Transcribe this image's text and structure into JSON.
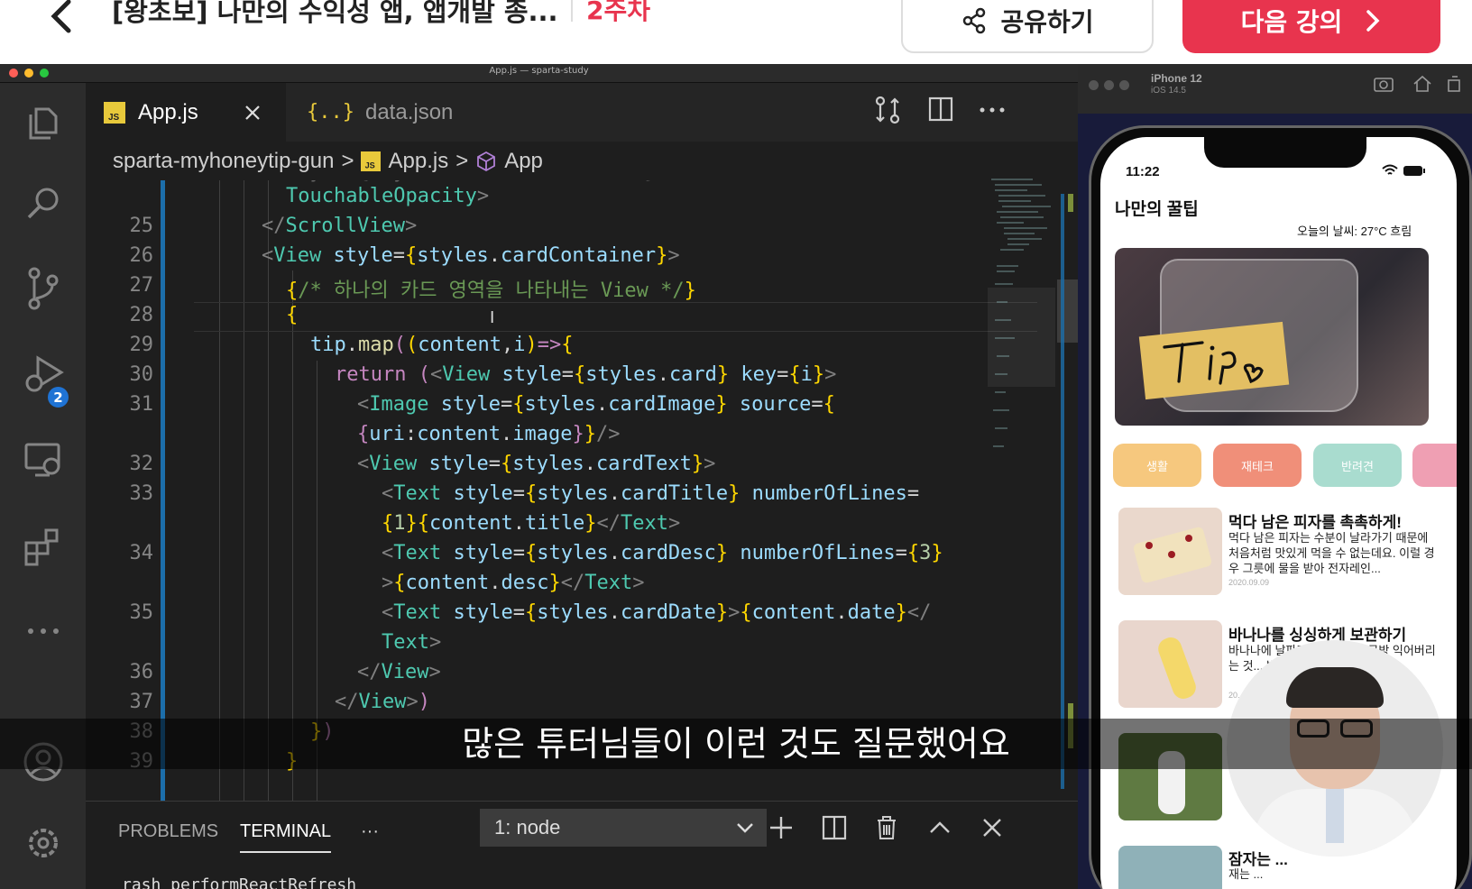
{
  "course": {
    "title": "[왕초보] 나만의 수익성 앱, 앱개발 종...",
    "week": "2주차",
    "share_label": "공유하기",
    "next_label": "다음 강의"
  },
  "window": {
    "title": "App.js — sparta-study"
  },
  "activity_bar": {
    "scm_badge": "2"
  },
  "editor": {
    "tabs": [
      {
        "label": "App.js",
        "icon": "js-file-icon",
        "active": true
      },
      {
        "label": "data.json",
        "icon": "json-file-icon",
        "active": false
      }
    ],
    "breadcrumb": [
      "sparta-myhoneytip-gun",
      "App.js",
      "App"
    ],
    "line_numbers": [
      "25",
      "26",
      "27",
      "28",
      "29",
      "30",
      "31",
      "",
      "32",
      "33",
      "",
      "34",
      "",
      "35",
      "",
      "36",
      "37",
      "38",
      "39"
    ]
  },
  "panel": {
    "tabs": [
      "PROBLEMS",
      "TERMINAL"
    ],
    "more_label": "···",
    "terminal_select": "1: node",
    "terminal_text": "rash performReactRefresh"
  },
  "simulator": {
    "device": "iPhone 12",
    "os": "iOS 14.5",
    "time": "11:22",
    "app_title": "나만의 꿀팁",
    "weather": "오늘의 날씨: 27°C 흐림",
    "chips": [
      {
        "label": "생활",
        "color": "#f6c87e"
      },
      {
        "label": "재테크",
        "color": "#f08f79"
      },
      {
        "label": "반려견",
        "color": "#a9dccf"
      }
    ],
    "cards": [
      {
        "title": "먹다 남은 피자를 촉촉하게!",
        "desc": "먹다 남은 피자는 수분이 날라가기 때문에 처음처럼 맛있게 먹을 수 없는데요. 이럴 경우 그릇에 물을 받아 전자레인...",
        "date": "2020.09.09"
      },
      {
        "title": "바나나를 싱싱하게 보관하기",
        "desc": "바나나에 날파리가 꼬이거나 금방 익어버리는 것... 방법이... 바나...",
        "date": "20..."
      },
      {
        "title": "잠자는 ...",
        "desc": "재는 ...",
        "date": ""
      }
    ]
  },
  "subtitle": "많은 튜터님들이 이런 것도 질문했어요"
}
